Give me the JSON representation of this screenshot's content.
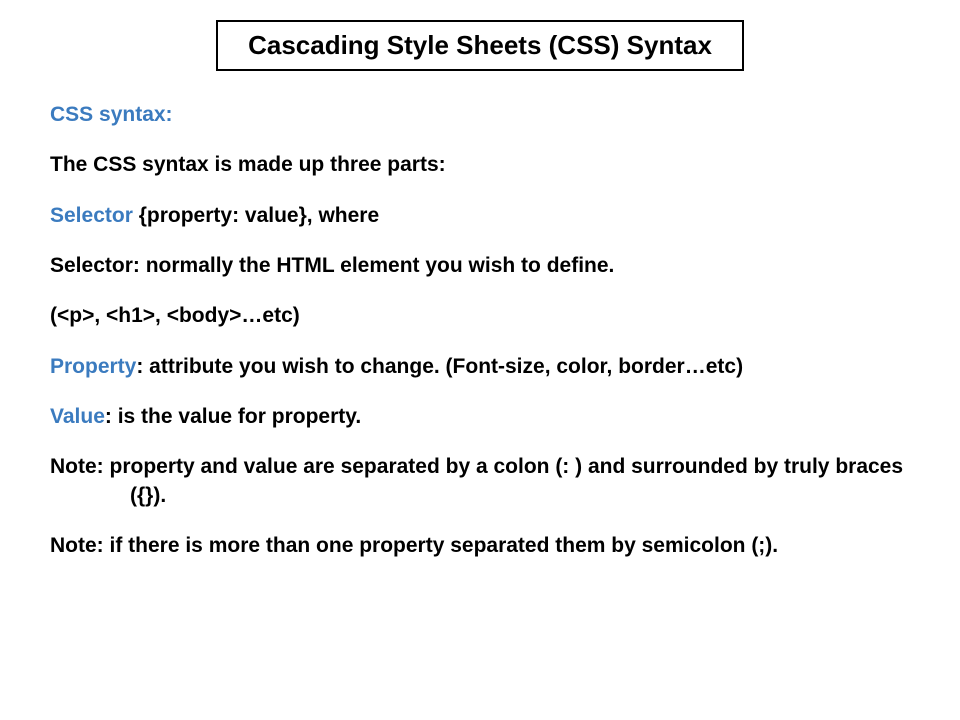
{
  "title": "Cascading Style Sheets (CSS) Syntax",
  "lines": {
    "l1_blue": "CSS syntax:",
    "l2": "The CSS syntax is made up three parts:",
    "l3_blue": "Selector ",
    "l3_rest": "{property: value}, where",
    "l4": "Selector: normally the HTML element you wish to define.",
    "l5": "(<p>, <h1>, <body>…etc)",
    "l6_blue": "Property",
    "l6_rest": ": attribute you wish to change. (Font-size, color, border…etc)",
    "l7_blue": "Value",
    "l7_rest": ": is the value for property.",
    "l8": "Note: property and value are separated by a colon (: ) and surrounded by truly braces ({}).",
    "l9": "Note: if there is more than one property separated them by semicolon (;)."
  }
}
